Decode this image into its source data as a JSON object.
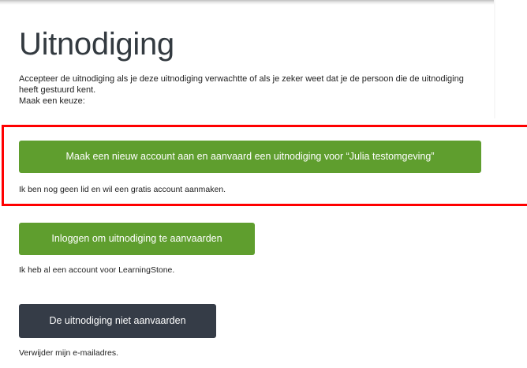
{
  "page": {
    "title": "Uitnodiging",
    "intro_line1": "Accepteer de uitnodiging als je deze uitnodiging verwachtte of als je zeker weet dat je de persoon die de uitnodiging heeft gestuurd kent.",
    "intro_line2": "Maak een keuze:"
  },
  "options": {
    "create_account": {
      "button_label": "Maak een nieuw account aan en aanvaard een uitnodiging voor “Julia testomgeving”",
      "hint": "Ik ben nog geen lid en wil een gratis account aanmaken."
    },
    "login": {
      "button_label": "Inloggen om uitnodiging te aanvaarden",
      "hint": "Ik heb al een account voor LearningStone."
    },
    "decline": {
      "button_label": "De uitnodiging niet aanvaarden",
      "hint": "Verwijder mijn e-mailadres."
    }
  },
  "colors": {
    "accept_button": "#5f9e2e",
    "decline_button": "#353c47",
    "highlight_border": "#ff0000",
    "title_text": "#333a40"
  }
}
